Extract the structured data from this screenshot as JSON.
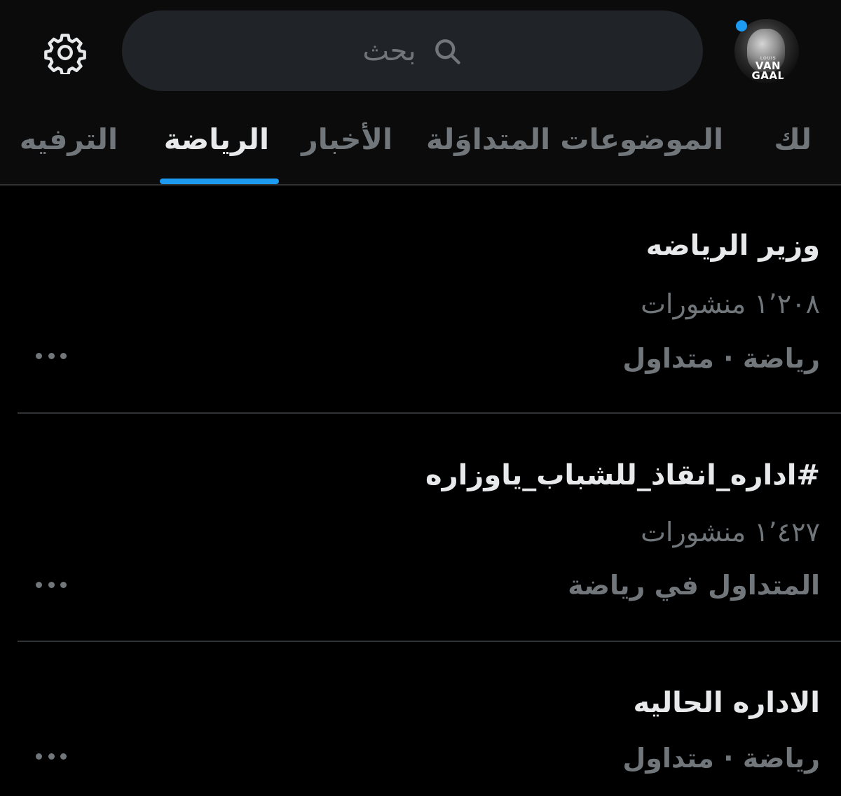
{
  "header": {
    "search": {
      "placeholder": "بحث"
    },
    "avatar": {
      "caption_small": "LOUIS",
      "caption": "VAN GAAL",
      "has_notification": true
    },
    "settings_icon": "gear-icon"
  },
  "tabs": [
    {
      "label": "لك",
      "active": false
    },
    {
      "label": "الموضوعات المتداوَلة",
      "active": false
    },
    {
      "label": "الأخبار",
      "active": false
    },
    {
      "label": "الرياضة",
      "active": true
    },
    {
      "label": "الترفيه",
      "active": false
    }
  ],
  "trends": [
    {
      "title": "وزير الرياضه",
      "posts": "١٬٢٠٨ منشورات",
      "context": "رياضة · متداول"
    },
    {
      "title": "#اداره_انقاذ_للشباب_ياوزاره",
      "posts": "١٬٤٢٧ منشورات",
      "context": "المتداول في رياضة"
    },
    {
      "title": "الاداره الحاليه",
      "context": "رياضة · متداول"
    }
  ],
  "colors": {
    "background": "#000000",
    "header_background": "#0b0b0c",
    "accent": "#1d9bf0",
    "primary_text": "#e7e9ea",
    "secondary_text": "#71767b",
    "divider": "#2f3336",
    "search_background": "#202327"
  }
}
